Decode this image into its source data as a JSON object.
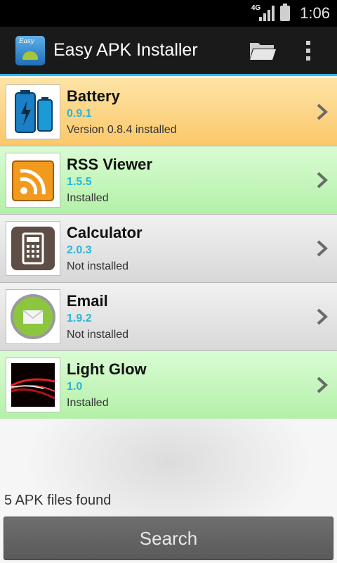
{
  "status_bar": {
    "network": "4G",
    "time": "1:06"
  },
  "action_bar": {
    "title": "Easy APK Installer",
    "app_icon_text": "Easy",
    "icons": [
      "app-logo-icon",
      "folder-icon",
      "overflow-menu-icon"
    ]
  },
  "apps": [
    {
      "name": "Battery",
      "version": "0.9.1",
      "status": "Version 0.8.4 installed",
      "row_color": "#fcc86a",
      "icon": "battery-icon"
    },
    {
      "name": "RSS Viewer",
      "version": "1.5.5",
      "status": "Installed",
      "row_color": "#b4f0a8",
      "icon": "rss-icon"
    },
    {
      "name": "Calculator",
      "version": "2.0.3",
      "status": "Not installed",
      "row_color": "#d8d8d8",
      "icon": "calculator-icon"
    },
    {
      "name": "Email",
      "version": "1.9.2",
      "status": "Not installed",
      "row_color": "#d8d8d8",
      "icon": "email-icon"
    },
    {
      "name": "Light Glow",
      "version": "1.0",
      "status": "Installed",
      "row_color": "#b4f0a8",
      "icon": "light-glow-icon"
    }
  ],
  "footer": {
    "count_text": "5 APK files found",
    "search_label": "Search"
  },
  "colors": {
    "accent": "#33b5e5",
    "version_text": "#29b6d8"
  }
}
